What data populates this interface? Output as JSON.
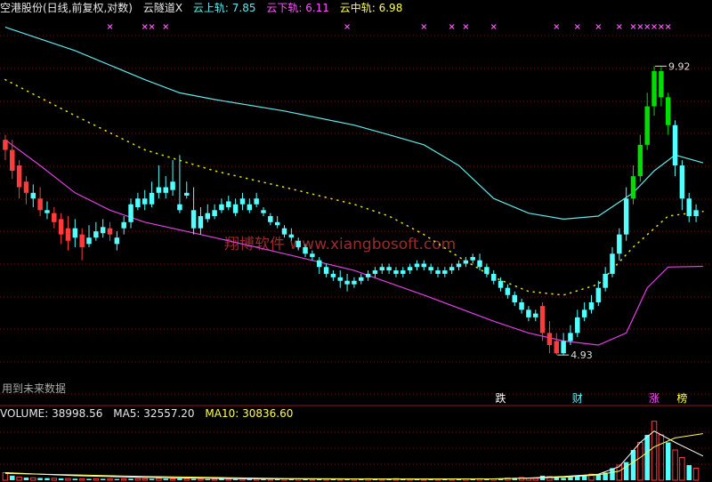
{
  "header": {
    "stock_name": "空港股份(日线,前复权,对数)",
    "indicator_name": "云隧道X",
    "upper_label": "云上轨:",
    "upper_value": "7.85",
    "lower_label": "云下轨:",
    "lower_value": "6.11",
    "middle_label": "云中轨:",
    "middle_value": "6.98"
  },
  "volume_header": {
    "volume_label": "VOLUME:",
    "volume_value": "38998.56",
    "ma5_label": "MA5:",
    "ma5_value": "32557.20",
    "ma10_label": "MA10:",
    "ma10_value": "30836.60"
  },
  "note": "用到未来数据",
  "watermark": "翔博软件 www.xiangbosoft.com",
  "colors": {
    "up": "#ff3b3b",
    "down": "#54ffff",
    "breakout": "#00dd00",
    "upper_band": "#5fe8e8",
    "lower_band": "#e040e0",
    "middle_dots": "#dddd00",
    "ma5": "#ffffff",
    "ma10": "#ffff55",
    "grid": "#7a1010",
    "marker_x": "#ff55ff",
    "label_white": "#ffffff",
    "label_cyan": "#54ffff",
    "label_magenta": "#ff55ff",
    "label_yellow": "#ffff55"
  },
  "chart_data": {
    "type": "candlestick",
    "y_scale": "log",
    "ylim": [
      4.4,
      11.2
    ],
    "n_bars": 100,
    "candles": [
      [
        0,
        8.3,
        8.1,
        8.4,
        7.9,
        "up"
      ],
      [
        1,
        8.1,
        7.7,
        8.3,
        7.55,
        "up"
      ],
      [
        2,
        7.8,
        7.4,
        7.9,
        7.2,
        "up"
      ],
      [
        3,
        7.5,
        7.3,
        7.6,
        7.1,
        "up"
      ],
      [
        4,
        7.3,
        7.2,
        7.45,
        7.05,
        "down"
      ],
      [
        5,
        7.2,
        7.0,
        7.4,
        6.9,
        "up"
      ],
      [
        6,
        7.0,
        6.95,
        7.15,
        6.85,
        "down"
      ],
      [
        7,
        6.95,
        6.8,
        7.05,
        6.7,
        "up"
      ],
      [
        8,
        6.85,
        6.6,
        6.95,
        6.45,
        "up"
      ],
      [
        9,
        6.7,
        6.5,
        6.9,
        6.35,
        "up"
      ],
      [
        10,
        6.55,
        6.7,
        6.85,
        6.4,
        "down"
      ],
      [
        11,
        6.6,
        6.4,
        6.7,
        6.2,
        "up"
      ],
      [
        12,
        6.45,
        6.55,
        6.75,
        6.4,
        "down"
      ],
      [
        13,
        6.55,
        6.65,
        6.8,
        6.5,
        "down"
      ],
      [
        14,
        6.62,
        6.72,
        6.85,
        6.55,
        "down"
      ],
      [
        15,
        6.7,
        6.6,
        6.8,
        6.5,
        "up"
      ],
      [
        16,
        6.55,
        6.45,
        6.65,
        6.35,
        "down"
      ],
      [
        17,
        6.7,
        6.8,
        6.9,
        6.6,
        "down"
      ],
      [
        18,
        6.8,
        7.1,
        7.2,
        6.7,
        "down"
      ],
      [
        19,
        7.05,
        7.2,
        7.3,
        7.0,
        "down"
      ],
      [
        20,
        7.2,
        7.1,
        7.35,
        7.0,
        "down"
      ],
      [
        21,
        7.1,
        7.3,
        7.5,
        7.05,
        "down"
      ],
      [
        22,
        7.3,
        7.4,
        7.8,
        7.2,
        "down"
      ],
      [
        23,
        7.4,
        7.3,
        7.6,
        7.2,
        "down"
      ],
      [
        24,
        7.35,
        7.5,
        7.9,
        7.25,
        "down"
      ],
      [
        25,
        7.1,
        7.0,
        8.0,
        6.95,
        "down"
      ],
      [
        26,
        7.25,
        7.3,
        7.5,
        7.2,
        "down"
      ],
      [
        27,
        7.0,
        6.7,
        7.4,
        6.6,
        "down"
      ],
      [
        28,
        6.7,
        6.9,
        7.05,
        6.6,
        "down"
      ],
      [
        29,
        6.85,
        6.95,
        7.1,
        6.8,
        "down"
      ],
      [
        30,
        6.9,
        7.0,
        7.1,
        6.85,
        "down"
      ],
      [
        31,
        7.0,
        7.1,
        7.2,
        6.95,
        "down"
      ],
      [
        32,
        7.05,
        7.15,
        7.25,
        7.0,
        "down"
      ],
      [
        33,
        7.1,
        6.95,
        7.2,
        6.9,
        "down"
      ],
      [
        34,
        7.1,
        7.2,
        7.3,
        7.0,
        "down"
      ],
      [
        35,
        7.1,
        7.0,
        7.2,
        6.95,
        "down"
      ],
      [
        36,
        7.1,
        7.2,
        7.3,
        7.05,
        "down"
      ],
      [
        37,
        7.0,
        6.95,
        7.05,
        6.9,
        "down"
      ],
      [
        38,
        6.9,
        6.8,
        6.95,
        6.75,
        "down"
      ],
      [
        39,
        6.8,
        6.75,
        6.9,
        6.7,
        "down"
      ],
      [
        40,
        6.7,
        6.6,
        6.75,
        6.55,
        "down"
      ],
      [
        41,
        6.6,
        6.55,
        6.7,
        6.5,
        "down"
      ],
      [
        42,
        6.5,
        6.4,
        6.55,
        6.35,
        "down"
      ],
      [
        43,
        6.4,
        6.3,
        6.45,
        6.25,
        "down"
      ],
      [
        44,
        6.3,
        6.25,
        6.35,
        6.2,
        "down"
      ],
      [
        45,
        6.2,
        6.1,
        6.25,
        6.0,
        "down"
      ],
      [
        46,
        6.1,
        6.0,
        6.15,
        5.95,
        "down"
      ],
      [
        47,
        6.0,
        5.95,
        6.05,
        5.9,
        "down"
      ],
      [
        48,
        5.95,
        5.9,
        6.05,
        5.8,
        "down"
      ],
      [
        49,
        5.9,
        5.85,
        6.0,
        5.75,
        "down"
      ],
      [
        50,
        5.85,
        5.9,
        5.95,
        5.8,
        "down"
      ],
      [
        51,
        5.9,
        5.95,
        6.0,
        5.85,
        "down"
      ],
      [
        52,
        5.95,
        6.0,
        6.05,
        5.9,
        "down"
      ],
      [
        53,
        6.0,
        6.05,
        6.1,
        5.95,
        "down"
      ],
      [
        54,
        6.05,
        6.1,
        6.15,
        6.0,
        "down"
      ],
      [
        55,
        6.1,
        6.05,
        6.15,
        6.0,
        "down"
      ],
      [
        56,
        6.05,
        6.0,
        6.1,
        5.95,
        "down"
      ],
      [
        57,
        6.0,
        6.05,
        6.1,
        5.95,
        "down"
      ],
      [
        58,
        6.05,
        6.1,
        6.15,
        6.0,
        "down"
      ],
      [
        59,
        6.1,
        6.15,
        6.2,
        6.05,
        "down"
      ],
      [
        60,
        6.15,
        6.1,
        6.2,
        6.05,
        "down"
      ],
      [
        61,
        6.1,
        6.05,
        6.15,
        6.0,
        "down"
      ],
      [
        62,
        6.05,
        6.0,
        6.1,
        5.95,
        "down"
      ],
      [
        63,
        6.0,
        6.05,
        6.1,
        5.95,
        "down"
      ],
      [
        64,
        6.05,
        6.1,
        6.15,
        6.0,
        "down"
      ],
      [
        65,
        6.1,
        6.15,
        6.2,
        6.05,
        "down"
      ],
      [
        66,
        6.15,
        6.2,
        6.25,
        6.1,
        "down"
      ],
      [
        67,
        6.2,
        6.25,
        6.3,
        6.15,
        "down"
      ],
      [
        68,
        6.2,
        6.1,
        6.3,
        6.05,
        "down"
      ],
      [
        69,
        6.1,
        6.0,
        6.15,
        5.95,
        "down"
      ],
      [
        70,
        6.0,
        5.9,
        6.05,
        5.85,
        "down"
      ],
      [
        71,
        5.9,
        5.8,
        5.95,
        5.75,
        "down"
      ],
      [
        72,
        5.8,
        5.7,
        5.85,
        5.65,
        "down"
      ],
      [
        73,
        5.7,
        5.6,
        5.75,
        5.55,
        "down"
      ],
      [
        74,
        5.6,
        5.5,
        5.65,
        5.45,
        "down"
      ],
      [
        75,
        5.5,
        5.4,
        5.55,
        5.35,
        "down"
      ],
      [
        76,
        5.45,
        5.4,
        5.5,
        5.35,
        "down"
      ],
      [
        77,
        5.55,
        5.2,
        5.6,
        5.1,
        "up"
      ],
      [
        78,
        5.2,
        5.05,
        5.35,
        4.95,
        "up"
      ],
      [
        79,
        5.1,
        4.95,
        5.2,
        4.93,
        "up"
      ],
      [
        80,
        4.95,
        5.1,
        5.2,
        4.93,
        "down"
      ],
      [
        81,
        5.1,
        5.2,
        5.3,
        5.05,
        "down"
      ],
      [
        82,
        5.2,
        5.4,
        5.5,
        5.15,
        "down"
      ],
      [
        83,
        5.4,
        5.5,
        5.6,
        5.35,
        "down"
      ],
      [
        84,
        5.5,
        5.6,
        5.7,
        5.45,
        "down"
      ],
      [
        85,
        5.6,
        5.8,
        5.9,
        5.55,
        "down"
      ],
      [
        86,
        5.8,
        6.0,
        6.1,
        5.75,
        "down"
      ],
      [
        87,
        6.0,
        6.3,
        6.4,
        5.95,
        "down"
      ],
      [
        88,
        6.3,
        6.6,
        6.7,
        6.2,
        "down"
      ],
      [
        89,
        6.6,
        7.2,
        7.4,
        6.5,
        "down"
      ],
      [
        90,
        7.2,
        7.6,
        7.8,
        7.1,
        "breakout"
      ],
      [
        91,
        7.6,
        8.2,
        8.4,
        7.5,
        "breakout"
      ],
      [
        92,
        8.2,
        9.0,
        9.3,
        8.1,
        "breakout"
      ],
      [
        93,
        9.0,
        9.8,
        9.92,
        8.8,
        "breakout"
      ],
      [
        94,
        9.8,
        9.2,
        9.9,
        9.0,
        "breakout"
      ],
      [
        95,
        9.2,
        8.6,
        9.3,
        8.4,
        "breakout"
      ],
      [
        96,
        8.6,
        7.8,
        8.7,
        7.6,
        "down"
      ],
      [
        97,
        7.8,
        7.2,
        7.9,
        7.0,
        "down"
      ],
      [
        98,
        7.2,
        6.9,
        7.3,
        6.8,
        "down"
      ],
      [
        99,
        6.9,
        7.0,
        7.1,
        6.8,
        "down"
      ]
    ],
    "upper_band": [
      [
        0,
        10.9
      ],
      [
        10,
        10.3
      ],
      [
        20,
        9.6
      ],
      [
        25,
        9.3
      ],
      [
        30,
        9.15
      ],
      [
        40,
        8.9
      ],
      [
        50,
        8.6
      ],
      [
        55,
        8.4
      ],
      [
        60,
        8.2
      ],
      [
        65,
        7.8
      ],
      [
        70,
        7.2
      ],
      [
        75,
        6.95
      ],
      [
        80,
        6.85
      ],
      [
        85,
        6.9
      ],
      [
        90,
        7.3
      ],
      [
        93,
        7.7
      ],
      [
        96,
        8.0
      ],
      [
        100,
        7.85
      ]
    ],
    "lower_band": [
      [
        0,
        8.3
      ],
      [
        5,
        7.8
      ],
      [
        10,
        7.3
      ],
      [
        15,
        7.0
      ],
      [
        20,
        6.8
      ],
      [
        30,
        6.55
      ],
      [
        40,
        6.3
      ],
      [
        50,
        6.05
      ],
      [
        60,
        5.7
      ],
      [
        70,
        5.35
      ],
      [
        75,
        5.2
      ],
      [
        80,
        5.1
      ],
      [
        85,
        5.05
      ],
      [
        89,
        5.2
      ],
      [
        92,
        5.8
      ],
      [
        95,
        6.1
      ],
      [
        100,
        6.11
      ]
    ],
    "middle_line": [
      [
        0,
        9.6
      ],
      [
        10,
        8.8
      ],
      [
        20,
        8.1
      ],
      [
        30,
        7.7
      ],
      [
        40,
        7.4
      ],
      [
        50,
        7.1
      ],
      [
        55,
        6.9
      ],
      [
        60,
        6.6
      ],
      [
        65,
        6.25
      ],
      [
        70,
        5.95
      ],
      [
        75,
        5.75
      ],
      [
        80,
        5.7
      ],
      [
        85,
        5.85
      ],
      [
        90,
        6.4
      ],
      [
        95,
        6.9
      ],
      [
        100,
        6.98
      ]
    ],
    "annotations": [
      {
        "label": "9.92",
        "x": 93,
        "y": 9.92
      },
      {
        "label": "4.93",
        "x": 79,
        "y": 4.93
      }
    ],
    "signal_labels": [
      {
        "label": "跌",
        "x": 71,
        "color_key": "label_white"
      },
      {
        "label": "财",
        "x": 82,
        "color_key": "label_cyan"
      },
      {
        "label": "涨",
        "x": 93,
        "color_key": "label_magenta"
      },
      {
        "label": "榜",
        "x": 97,
        "color_key": "label_yellow"
      }
    ],
    "top_markers": [
      15,
      20,
      21,
      23,
      49,
      60,
      64,
      66,
      70,
      79,
      82,
      85,
      88,
      90,
      91,
      92,
      93,
      94,
      95
    ],
    "volume": {
      "values": [
        5000,
        3000,
        2000,
        1800,
        1600,
        1500,
        1400,
        1300,
        1200,
        1100,
        1000,
        900,
        900,
        1000,
        900,
        800,
        800,
        900,
        1000,
        1100,
        1000,
        900,
        1200,
        1000,
        900,
        1100,
        1000,
        900,
        800,
        700,
        800,
        900,
        800,
        700,
        800,
        700,
        800,
        700,
        600,
        700,
        800,
        900,
        900,
        700,
        600,
        600,
        700,
        800,
        600,
        700,
        800,
        900,
        1000,
        800,
        700,
        1200,
        1100,
        1000,
        900,
        800,
        700,
        800,
        700,
        600,
        700,
        800,
        900,
        800,
        1000,
        700,
        900,
        1000,
        1500,
        1600,
        1800,
        1400,
        1200,
        3000,
        2500,
        2000,
        1500,
        2000,
        2500,
        3000,
        4000,
        3500,
        5000,
        8000,
        10000,
        12000,
        20000,
        25000,
        30000,
        38998.56,
        30000,
        25000,
        20000,
        15000,
        10000,
        8000
      ],
      "colors": [
        "up",
        "down",
        "up",
        "down",
        "up",
        "down",
        "down",
        "up",
        "down",
        "up",
        "down",
        "up",
        "down",
        "up",
        "down",
        "up",
        "down",
        "up",
        "down",
        "up",
        "up",
        "down",
        "up",
        "down",
        "up",
        "down",
        "up",
        "down",
        "up",
        "down",
        "up",
        "down",
        "up",
        "down",
        "up",
        "down",
        "up",
        "down",
        "up",
        "down",
        "up",
        "down",
        "up",
        "down",
        "up",
        "down",
        "up",
        "down",
        "up",
        "down",
        "up",
        "down",
        "up",
        "down",
        "up",
        "down",
        "up",
        "down",
        "up",
        "down",
        "up",
        "down",
        "up",
        "down",
        "up",
        "down",
        "up",
        "down",
        "up",
        "down",
        "up",
        "down",
        "up",
        "down",
        "up",
        "up",
        "up",
        "down",
        "up",
        "down",
        "down",
        "down",
        "down",
        "down",
        "up",
        "down",
        "down",
        "down",
        "up",
        "down",
        "down",
        "up",
        "down",
        "up",
        "up",
        "down",
        "up",
        "up",
        "down",
        "up"
      ],
      "ma5": [
        [
          0,
          5000
        ],
        [
          10,
          3000
        ],
        [
          20,
          1800
        ],
        [
          30,
          1200
        ],
        [
          40,
          900
        ],
        [
          50,
          800
        ],
        [
          60,
          700
        ],
        [
          70,
          900
        ],
        [
          75,
          1500
        ],
        [
          80,
          2500
        ],
        [
          85,
          4000
        ],
        [
          88,
          9000
        ],
        [
          91,
          25000
        ],
        [
          93,
          32557.2
        ],
        [
          96,
          25000
        ],
        [
          100,
          16000
        ]
      ],
      "ma10": [
        [
          0,
          4500
        ],
        [
          10,
          3500
        ],
        [
          20,
          2500
        ],
        [
          30,
          1800
        ],
        [
          40,
          1100
        ],
        [
          50,
          900
        ],
        [
          60,
          800
        ],
        [
          70,
          900
        ],
        [
          75,
          1300
        ],
        [
          80,
          2000
        ],
        [
          85,
          3500
        ],
        [
          88,
          6000
        ],
        [
          91,
          15000
        ],
        [
          93,
          22000
        ],
        [
          96,
          28000
        ],
        [
          100,
          30836.6
        ]
      ],
      "ylim": [
        0,
        40000
      ]
    }
  }
}
